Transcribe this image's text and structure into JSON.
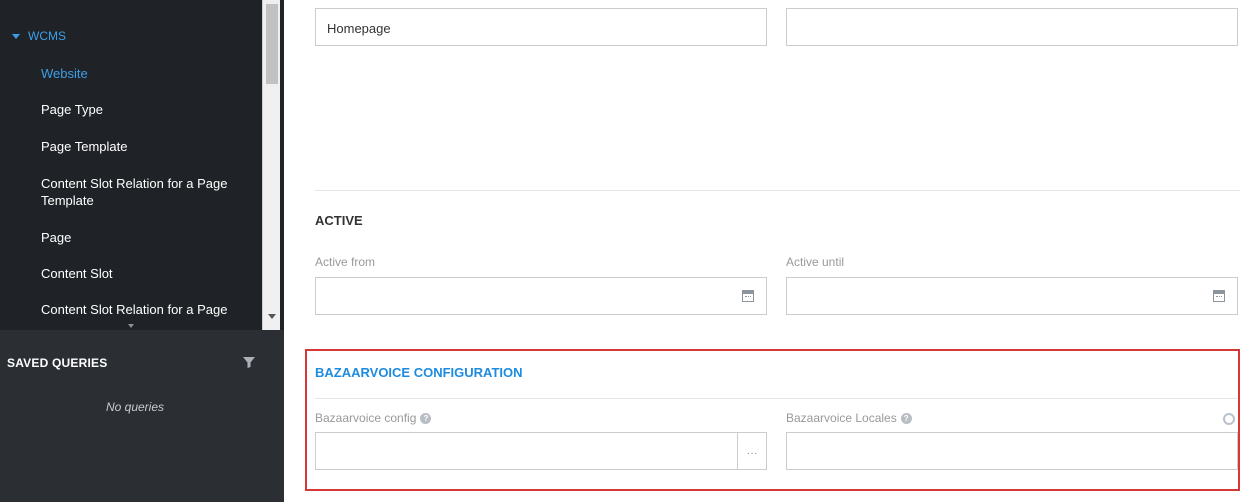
{
  "sidebar": {
    "group_label": "WCMS",
    "items": [
      {
        "label": "Website",
        "active": true
      },
      {
        "label": "Page Type",
        "active": false
      },
      {
        "label": "Page Template",
        "active": false
      },
      {
        "label": "Content Slot Relation for a Page Template",
        "active": false
      },
      {
        "label": "Page",
        "active": false
      },
      {
        "label": "Content Slot",
        "active": false
      },
      {
        "label": "Content Slot Relation for a Page",
        "active": false
      }
    ],
    "saved_queries": {
      "title": "SAVED QUERIES",
      "empty_text": "No queries",
      "filter_icon": "filter-icon"
    }
  },
  "main": {
    "top_fields": {
      "left_value": "Homepage",
      "right_value": ""
    },
    "active_section": {
      "title": "ACTIVE",
      "active_from_label": "Active from",
      "active_from_value": "",
      "active_until_label": "Active until",
      "active_until_value": "",
      "calendar_icon": "calendar-icon"
    },
    "bazaarvoice_section": {
      "title": "BAZAARVOICE CONFIGURATION",
      "config_label": "Bazaarvoice config",
      "config_value": "",
      "config_button": "...",
      "locales_label": "Bazaarvoice Locales",
      "locales_value": "",
      "help_icon": "help-icon"
    }
  },
  "colors": {
    "sidebar_bg": "#2b2f34",
    "nav_bg": "#1f2327",
    "accent": "#3d9ee8",
    "highlight_border": "#d63838",
    "section_title_blue": "#1d8be0"
  }
}
